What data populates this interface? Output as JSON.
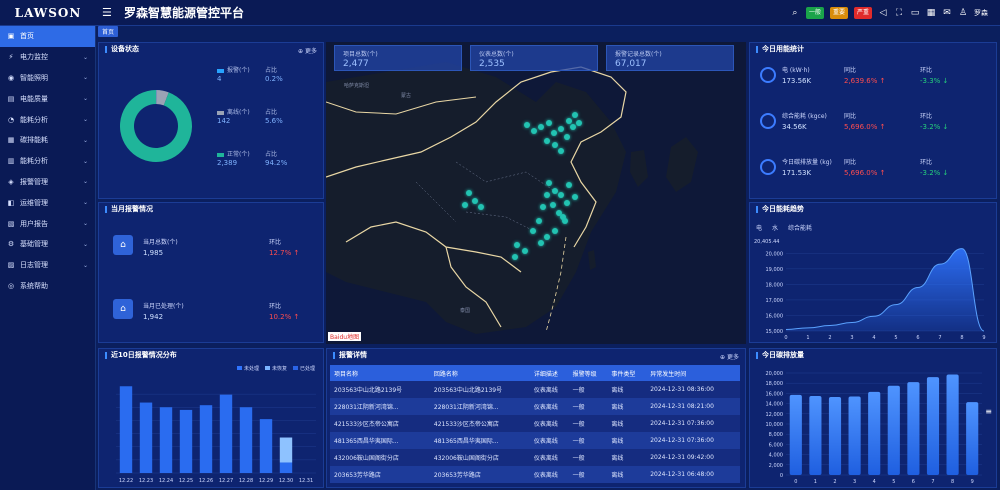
{
  "header": {
    "logo": "LAWSON",
    "title": "罗森智慧能源管控平台",
    "badges": [
      {
        "label": "一般",
        "color": "#1aa34a"
      },
      {
        "label": "重要",
        "color": "#d98c0a"
      },
      {
        "label": "严重",
        "color": "#e02b2b"
      }
    ],
    "user": "罗森"
  },
  "sidebar": {
    "items": [
      {
        "icon": "home-icon",
        "glyph": "▣",
        "label": "首页",
        "active": true,
        "chevron": false
      },
      {
        "icon": "meter-icon",
        "glyph": "⚡",
        "label": "电力监控",
        "chevron": true
      },
      {
        "icon": "bulb-icon",
        "glyph": "◉",
        "label": "智能照明",
        "chevron": true
      },
      {
        "icon": "quality-icon",
        "glyph": "▤",
        "label": "电能质量",
        "chevron": true
      },
      {
        "icon": "analysis-icon",
        "glyph": "◔",
        "label": "能耗分析",
        "chevron": true
      },
      {
        "icon": "carbon-icon",
        "glyph": "▦",
        "label": "碳排能耗",
        "chevron": true
      },
      {
        "icon": "bar-icon",
        "glyph": "▥",
        "label": "能耗分析",
        "chevron": true
      },
      {
        "icon": "alarm-icon",
        "glyph": "◈",
        "label": "报警管理",
        "chevron": true
      },
      {
        "icon": "ops-icon",
        "glyph": "◧",
        "label": "运维管理",
        "chevron": true
      },
      {
        "icon": "report-icon",
        "glyph": "▧",
        "label": "用户报告",
        "chevron": true
      },
      {
        "icon": "settings-icon",
        "glyph": "⚙",
        "label": "基础管理",
        "chevron": true
      },
      {
        "icon": "log-icon",
        "glyph": "▨",
        "label": "日志管理",
        "chevron": true
      },
      {
        "icon": "help-icon",
        "glyph": "◎",
        "label": "系统帮助",
        "chevron": false
      }
    ]
  },
  "breadcrumb": "首页",
  "device_status": {
    "title": "设备状态",
    "more": "更多",
    "ratio_label": "占比",
    "rows": [
      {
        "label": "报警(个)",
        "count": "4",
        "ratio": "0.2%",
        "color": "#27a3ff"
      },
      {
        "label": "离线(个)",
        "count": "142",
        "ratio": "5.6%",
        "color": "#9aa3b5"
      },
      {
        "label": "正常(个)",
        "count": "2,389",
        "ratio": "94.2%",
        "color": "#1fb59a"
      }
    ]
  },
  "monthly_alarm": {
    "title": "当月报警情况",
    "ratio_label": "环比",
    "rows": [
      {
        "label": "当月总数(个)",
        "value": "1,985",
        "ratio": "12.7%",
        "arrow": "↑"
      },
      {
        "label": "当月已处理(个)",
        "value": "1,942",
        "ratio": "10.2%",
        "arrow": "↑"
      }
    ]
  },
  "map": {
    "stats": [
      {
        "label": "项目总数(个)",
        "value": "2,477"
      },
      {
        "label": "仪表总数(个)",
        "value": "2,535"
      },
      {
        "label": "报警记录总数(个)",
        "value": "67,017"
      }
    ],
    "provider": "Baidu地图"
  },
  "today_energy": {
    "title": "今日用能统计",
    "mom_label": "同比",
    "yoy_label": "环比",
    "rows": [
      {
        "label": "电 (kW·h)",
        "value": "173.56K",
        "tb": "2,639.6%",
        "tb_arrow": "↑",
        "hb": "-3.3%",
        "hb_arrow": "↓",
        "icon": "electric-icon"
      },
      {
        "label": "综合能耗 (kgce)",
        "value": "34.56K",
        "tb": "5,696.0%",
        "tb_arrow": "↑",
        "hb": "-3.2%",
        "hb_arrow": "↓",
        "icon": "energy-icon"
      },
      {
        "label": "今日碳排放量 (kg)",
        "value": "171.53K",
        "tb": "5,696.0%",
        "tb_arrow": "↑",
        "hb": "-3.2%",
        "hb_arrow": "↓",
        "icon": "carbon-emission-icon"
      }
    ]
  },
  "energy_trend": {
    "title": "今日能耗趋势",
    "tabs": [
      "电",
      "水",
      "综合能耗"
    ]
  },
  "alarm_distribution": {
    "title": "近10日报警情况分布",
    "legend": [
      "未处理",
      "未恢复",
      "已处理"
    ]
  },
  "alarm_detail": {
    "title": "报警详情",
    "more": "更多",
    "columns": [
      "项目名称",
      "回路名称",
      "详细描述",
      "报警等级",
      "事件类型",
      "异常发生时间"
    ],
    "rows": [
      [
        "203563中山北路2139号",
        "203563中山北路2139号",
        "仪表离线",
        "一般",
        "离线",
        "2024-12-31 08:36:00"
      ],
      [
        "228031江阴新河湾锦...",
        "228031江阴新河湾锦...",
        "仪表离线",
        "一般",
        "离线",
        "2024-12-31 08:21:00"
      ],
      [
        "421533沙区杰帝公寓店",
        "421533沙区杰帝公寓店",
        "仪表离线",
        "一般",
        "离线",
        "2024-12-31 07:36:00"
      ],
      [
        "481365西昌华夷国际...",
        "481365西昌华夷国际...",
        "仪表离线",
        "一般",
        "离线",
        "2024-12-31 07:36:00"
      ],
      [
        "432006鞍山国阁街分店",
        "432006鞍山国阁街分店",
        "仪表离线",
        "一般",
        "离线",
        "2024-12-31 09:42:00"
      ],
      [
        "203653芳华路店",
        "203653芳华路店",
        "仪表离线",
        "一般",
        "离线",
        "2024-12-31 06:48:00"
      ]
    ]
  },
  "today_carbon": {
    "title": "今日碳排放量"
  },
  "chart_data": [
    {
      "type": "pie",
      "title": "设备状态",
      "categories": [
        "报警(个)",
        "离线(个)",
        "正常(个)"
      ],
      "values": [
        4,
        142,
        2389
      ]
    },
    {
      "type": "area",
      "title": "今日能耗趋势",
      "x": [
        0,
        1,
        2,
        3,
        4,
        5,
        6,
        7,
        8,
        9
      ],
      "y_top_label": "20,405.44",
      "yticks": [
        "20,000",
        "19,000",
        "18,000",
        "17,000",
        "16,000",
        "15,000"
      ],
      "series": [
        {
          "values": [
            15100,
            15200,
            15350,
            15550,
            15950,
            16700,
            17800,
            19300,
            20300,
            15000
          ]
        }
      ],
      "ylim": [
        15000,
        20405.44
      ]
    },
    {
      "type": "bar",
      "title": "近10日报警情况分布",
      "categories": [
        "12.22",
        "12.23",
        "12.24",
        "12.25",
        "12.26",
        "12.27",
        "12.28",
        "12.29",
        "12.30",
        "12.31"
      ],
      "series": [
        {
          "name": "未处理",
          "values": [
            0,
            0,
            0,
            0,
            0,
            0,
            0,
            0,
            0,
            0
          ]
        },
        {
          "name": "未恢复",
          "values": [
            0,
            0,
            0,
            0,
            0,
            0,
            0,
            0,
            95,
            0
          ]
        },
        {
          "name": "已处理",
          "values": [
            330,
            268,
            250,
            240,
            258,
            298,
            250,
            205,
            40,
            0
          ]
        }
      ],
      "ylim": [
        0,
        350
      ]
    },
    {
      "type": "bar",
      "title": "今日碳排放量",
      "categories": [
        "0",
        "1",
        "2",
        "3",
        "4",
        "5",
        "6",
        "7",
        "8",
        "9"
      ],
      "yticks": [
        "20,000",
        "18,000",
        "16,000",
        "14,000",
        "12,000",
        "10,000",
        "8,000",
        "6,000",
        "4,000",
        "2,000",
        "0"
      ],
      "values": [
        15700,
        15500,
        15300,
        15400,
        16300,
        17500,
        18200,
        19200,
        19700,
        14300
      ],
      "ylim": [
        0,
        20000
      ]
    }
  ]
}
